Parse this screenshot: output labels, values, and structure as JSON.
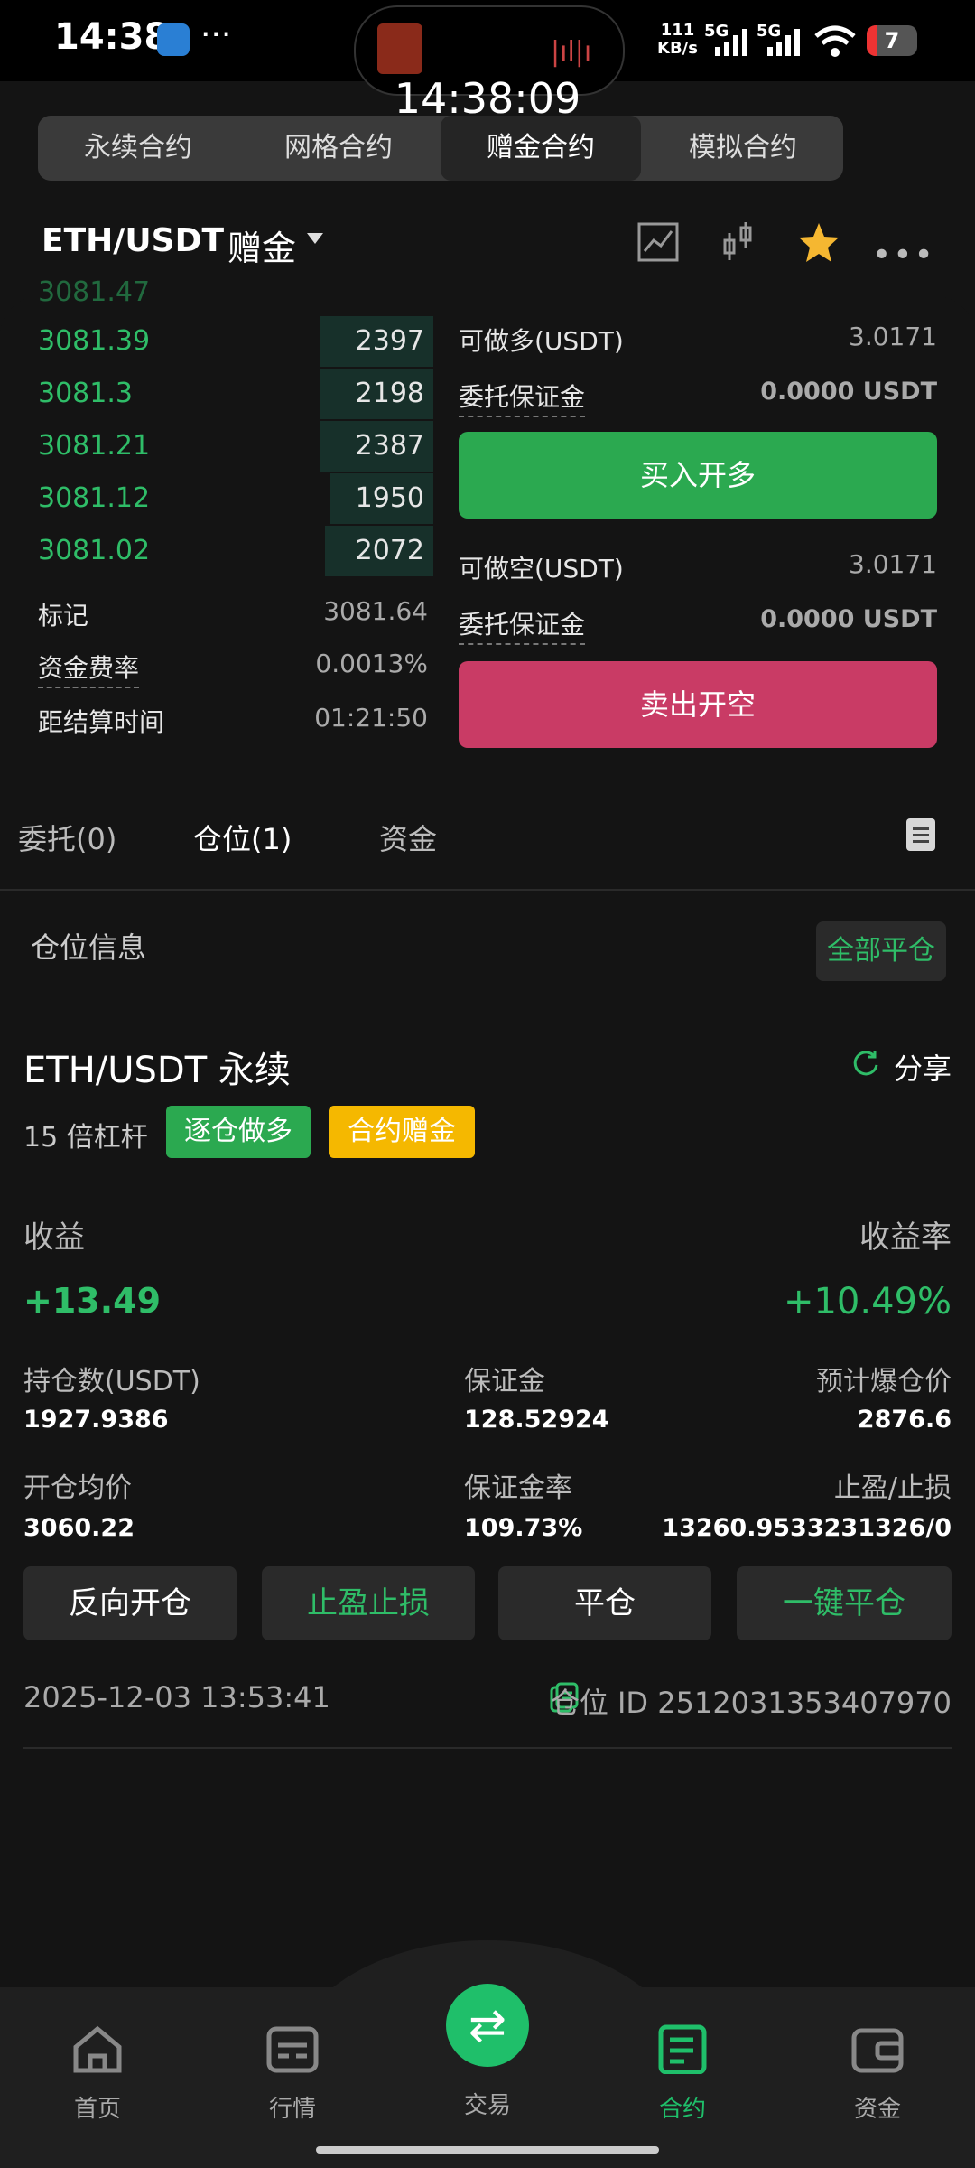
{
  "status_bar": {
    "time": "14:38",
    "more": "···",
    "net_speed_top": "111",
    "net_speed_bottom": "KB/s",
    "sig1": "5G",
    "sig2": "5G",
    "battery": "7"
  },
  "overlay_clock": "14:38:09",
  "top_tabs": [
    "永续合约",
    "网格合约",
    "赠金合约",
    "模拟合约"
  ],
  "top_tab_active_index": 2,
  "pair": {
    "name": "ETH/USDT",
    "tag": "赠金"
  },
  "orderbook": {
    "rows": [
      {
        "price": "3081.39",
        "qty": "2397",
        "depth": 0.45
      },
      {
        "price": "3081.3",
        "qty": "2198",
        "depth": 0.42
      },
      {
        "price": "3081.21",
        "qty": "2387",
        "depth": 0.45
      },
      {
        "price": "3081.12",
        "qty": "1950",
        "depth": 0.38
      },
      {
        "price": "3081.02",
        "qty": "2072",
        "depth": 0.4
      }
    ],
    "mark_label": "标记",
    "mark_value": "3081.64",
    "funding_label": "资金费率",
    "funding_value": "0.0013%",
    "settle_label": "距结算时间",
    "settle_value": "01:21:50"
  },
  "trade": {
    "long_avail_label": "可做多(USDT)",
    "long_avail_value": "3.0171",
    "long_margin_label": "委托保证金",
    "long_margin_value": "0.0000 USDT",
    "long_button": "买入开多",
    "short_avail_label": "可做空(USDT)",
    "short_avail_value": "3.0171",
    "short_margin_label": "委托保证金",
    "short_margin_value": "0.0000 USDT",
    "short_button": "卖出开空"
  },
  "sub_tabs": [
    "委托(0)",
    "仓位(1)",
    "资金"
  ],
  "sub_tab_active_index": 1,
  "position": {
    "section_title": "仓位信息",
    "close_all": "全部平仓",
    "symbol": "ETH/USDT 永续",
    "share": "分享",
    "leverage": "15 倍杠杆",
    "badge_mode": "逐仓做多",
    "badge_bonus": "合约赠金",
    "pnl_label": "收益",
    "pnl_value": "+13.49",
    "roe_label": "收益率",
    "roe_value": "+10.49%",
    "size_label": "持仓数(USDT)",
    "size_value": "1927.9386",
    "margin_label": "保证金",
    "margin_value": "128.52924",
    "liq_label": "预计爆仓价",
    "liq_value": "2876.6",
    "entry_label": "开仓均价",
    "entry_value": "3060.22",
    "margin_rate_label": "保证金率",
    "margin_rate_value": "109.73%",
    "tpsl_label": "止盈/止损",
    "tpsl_value": "13260.9533231326/0",
    "btn_reverse": "反向开仓",
    "btn_tpsl": "止盈止损",
    "btn_close": "平仓",
    "btn_close_one": "一键平仓",
    "timestamp": "2025-12-03 13:53:41",
    "position_id": "仓位 ID 2512031353407970"
  },
  "bottom_nav": [
    "首页",
    "行情",
    "交易",
    "合约",
    "资金"
  ],
  "bottom_nav_active_index": 3,
  "colors": {
    "green": "#2fbd68",
    "red": "#c93b65",
    "star": "#f5b731",
    "bonus": "#f5b800"
  }
}
